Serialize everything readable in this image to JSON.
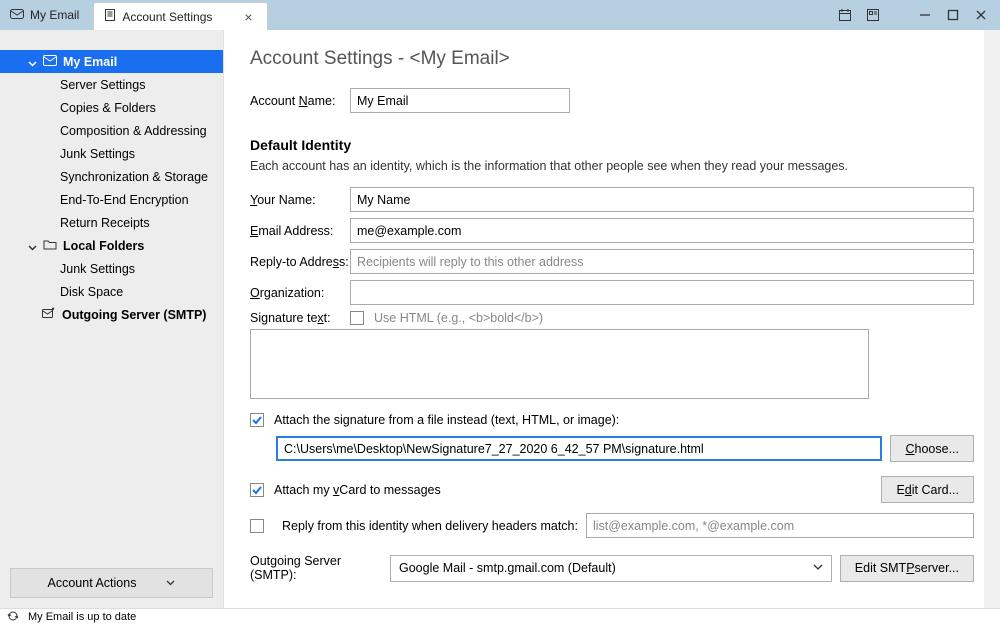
{
  "titlebar": {
    "tab_inactive": "My Email",
    "tab_active": "Account Settings"
  },
  "sidebar": {
    "root_account": "My Email",
    "account_items": [
      "Server Settings",
      "Copies & Folders",
      "Composition & Addressing",
      "Junk Settings",
      "Synchronization & Storage",
      "End-To-End Encryption",
      "Return Receipts"
    ],
    "local_folders": "Local Folders",
    "local_items": [
      "Junk Settings",
      "Disk Space"
    ],
    "outgoing": "Outgoing Server (SMTP)",
    "account_actions": "Account Actions"
  },
  "page": {
    "title_prefix": "Account Settings - ",
    "title_account": "<My Email>",
    "account_name_label_pre": "Account ",
    "account_name_underline": "N",
    "account_name_after": "ame:",
    "account_name_value": "My Email",
    "identity_heading": "Default Identity",
    "identity_desc": "Each account has an identity, which is the information that other people see when they read your messages.",
    "your_name_u": "Y",
    "your_name_rest": "our Name:",
    "your_name_value": "My Name",
    "email_u": "E",
    "email_rest": "mail Address:",
    "email_value": "me@example.com",
    "reply_pre": "Reply-to Addre",
    "reply_u": "s",
    "reply_after": "s:",
    "reply_placeholder": "Recipients will reply to this other address",
    "org_u": "O",
    "org_rest": "rganization:",
    "sig_pre": "Signature te",
    "sig_u": "x",
    "sig_after": "t:",
    "use_html_pre": "Use HTML (e.g., <b>bold</b>)",
    "attach_file_label": "Attach the signature from a file instead (text, HTML, or image):",
    "sig_file_value": "C:\\Users\\me\\Desktop\\NewSignature7_27_2020 6_42_57 PM\\signature.html",
    "choose_u": "C",
    "choose_rest": "hoose...",
    "attach_vcard_pre": "Attach my ",
    "attach_vcard_u": "v",
    "attach_vcard_after": "Card to messages",
    "edit_card_pre": "E",
    "edit_card_u": "d",
    "edit_card_after": "it Card...",
    "reply_headers_label": "Reply from this identity when delivery headers match:",
    "reply_headers_placeholder": "list@example.com, *@example.com",
    "outgoing_label": "Outgoing Server (SMTP):",
    "outgoing_value": "Google Mail - smtp.gmail.com (Default)",
    "edit_smtp_pre": "Edit SMT",
    "edit_smtp_u": "P",
    "edit_smtp_after": " server..."
  },
  "status": "My Email is up to date"
}
